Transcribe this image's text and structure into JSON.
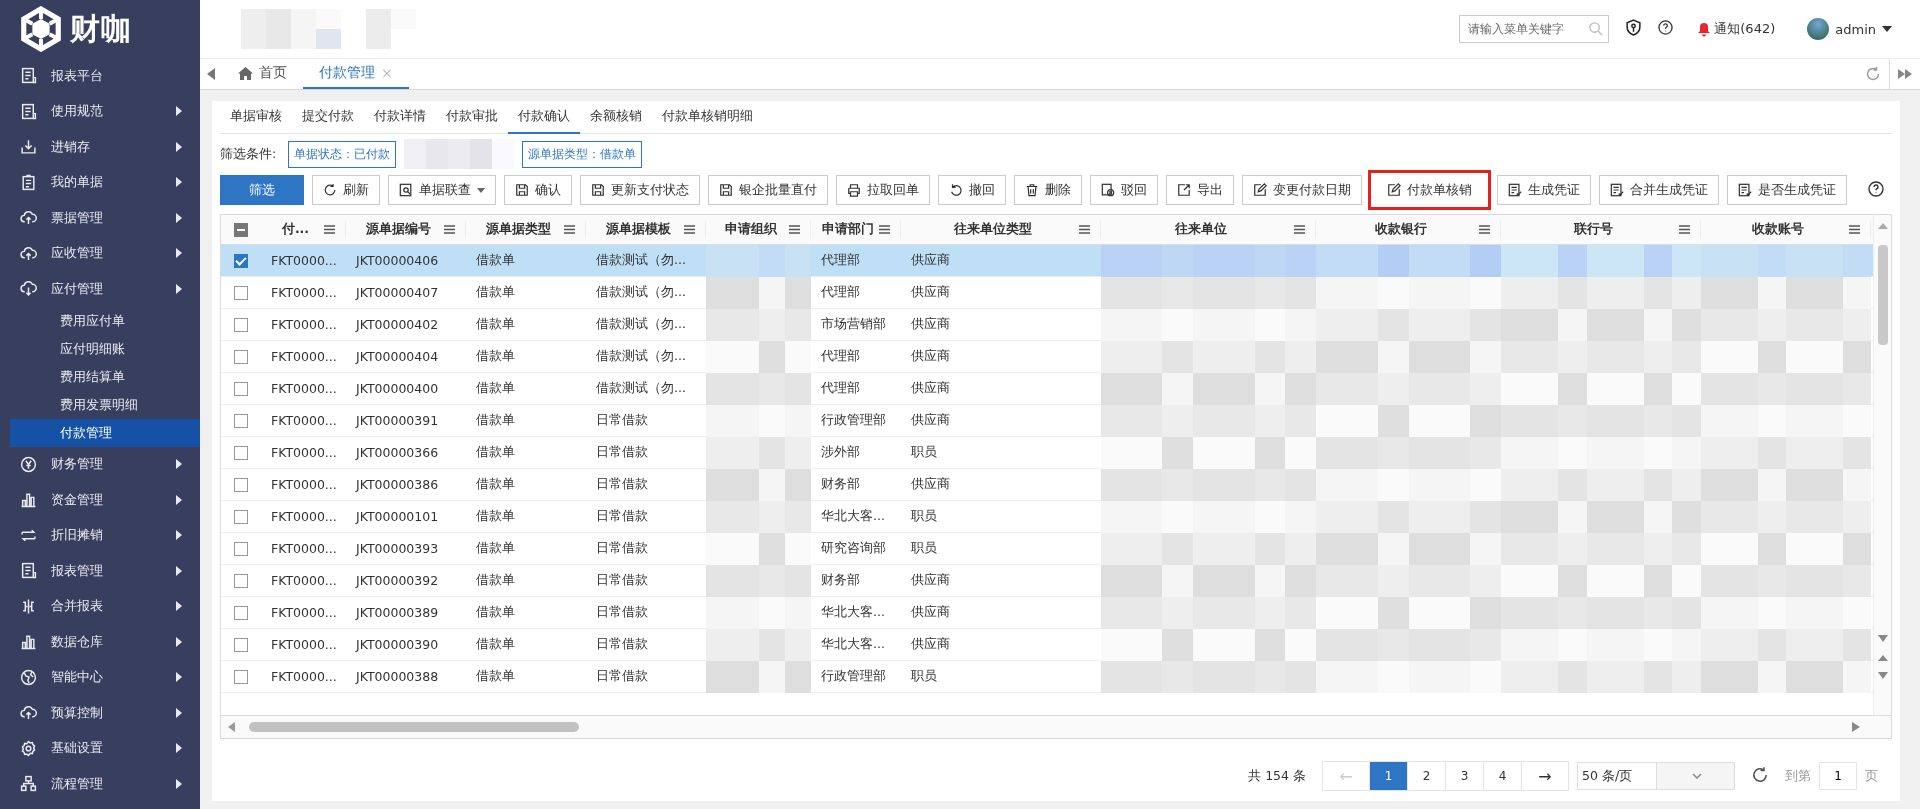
{
  "logo": {
    "text": "财咖"
  },
  "sidebar": {
    "items": [
      {
        "label": "报表平台",
        "kind": "report",
        "expandable": false,
        "selected": false
      },
      {
        "label": "使用规范",
        "kind": "report",
        "expandable": true,
        "selected": false
      },
      {
        "label": "进销存",
        "kind": "download",
        "expandable": true,
        "selected": false
      },
      {
        "label": "我的单据",
        "kind": "clipboard",
        "expandable": true,
        "selected": false
      },
      {
        "label": "票据管理",
        "kind": "cloud-up",
        "expandable": true,
        "selected": false
      },
      {
        "label": "应收管理",
        "kind": "cloud-up",
        "expandable": true,
        "selected": false
      },
      {
        "label": "应付管理",
        "kind": "cloud-down",
        "expandable": true,
        "selected": false,
        "children": [
          {
            "label": "费用应付单",
            "selected": false
          },
          {
            "label": "应付明细账",
            "selected": false
          },
          {
            "label": "费用结算单",
            "selected": false
          },
          {
            "label": "费用发票明细",
            "selected": false
          },
          {
            "label": "付款管理",
            "selected": true
          }
        ]
      },
      {
        "label": "财务管理",
        "kind": "yen",
        "expandable": true,
        "selected": false
      },
      {
        "label": "资金管理",
        "kind": "bars",
        "expandable": true,
        "selected": false
      },
      {
        "label": "折旧摊销",
        "kind": "swap",
        "expandable": true,
        "selected": false
      },
      {
        "label": "报表管理",
        "kind": "report",
        "expandable": true,
        "selected": false
      },
      {
        "label": "合并报表",
        "kind": "merge",
        "expandable": true,
        "selected": false
      },
      {
        "label": "数据仓库",
        "kind": "bars",
        "expandable": true,
        "selected": false
      },
      {
        "label": "智能中心",
        "kind": "globe",
        "expandable": true,
        "selected": false
      },
      {
        "label": "预算控制",
        "kind": "cloud-up",
        "expandable": true,
        "selected": false
      },
      {
        "label": "基础设置",
        "kind": "gear",
        "expandable": true,
        "selected": false
      },
      {
        "label": "流程管理",
        "kind": "flow",
        "expandable": true,
        "selected": false
      }
    ]
  },
  "header": {
    "search": {
      "placeholder": "请输入菜单关键字"
    },
    "notifications": "通知(642)",
    "user": "admin"
  },
  "tabs": [
    {
      "label": "首页",
      "kind": "home",
      "selected": false
    },
    {
      "label": "付款管理",
      "kind": "page",
      "selected": true,
      "close": "×"
    }
  ],
  "subtabs": [
    {
      "label": "单据审核",
      "selected": false
    },
    {
      "label": "提交付款",
      "selected": false
    },
    {
      "label": "付款详情",
      "selected": false
    },
    {
      "label": "付款审批",
      "selected": false
    },
    {
      "label": "付款确认",
      "selected": true
    },
    {
      "label": "余额核销",
      "selected": false
    },
    {
      "label": "付款单核销明细",
      "selected": false
    }
  ],
  "filter": {
    "label": "筛选条件:",
    "chips": [
      "单据状态：已付款",
      "源单据类型：借款单"
    ]
  },
  "toolbar": [
    {
      "label": "筛选",
      "kind": "primary",
      "highlighted": false
    },
    {
      "label": "刷新",
      "kind": "refresh",
      "highlighted": false
    },
    {
      "label": "单据联查",
      "kind": "search-doc",
      "dropdown": true,
      "highlighted": false
    },
    {
      "label": "确认",
      "kind": "save",
      "highlighted": false
    },
    {
      "label": "更新支付状态",
      "kind": "save",
      "highlighted": false
    },
    {
      "label": "银企批量直付",
      "kind": "save",
      "highlighted": false
    },
    {
      "label": "拉取回单",
      "kind": "printer",
      "highlighted": false
    },
    {
      "label": "撤回",
      "kind": "undo",
      "highlighted": false
    },
    {
      "label": "删除",
      "kind": "trash",
      "highlighted": false
    },
    {
      "label": "驳回",
      "kind": "cancel",
      "highlighted": false
    },
    {
      "label": "导出",
      "kind": "export",
      "highlighted": false
    },
    {
      "label": "变更付款日期",
      "kind": "edit",
      "highlighted": false
    },
    {
      "label": "付款单核销",
      "kind": "edit",
      "highlighted": true
    },
    {
      "label": "生成凭证",
      "kind": "list",
      "highlighted": false
    },
    {
      "label": "合并生成凭证",
      "kind": "list",
      "highlighted": false
    },
    {
      "label": "是否生成凭证",
      "kind": "list",
      "highlighted": false
    }
  ],
  "table": {
    "select_all_partial": true,
    "columns": [
      {
        "label": "付..."
      },
      {
        "label": "源单据编号"
      },
      {
        "label": "源单据类型"
      },
      {
        "label": "源单据模板"
      },
      {
        "label": "申请组织"
      },
      {
        "label": "申请部门"
      },
      {
        "label": "往来单位类型"
      },
      {
        "label": "往来单位"
      },
      {
        "label": "收款银行"
      },
      {
        "label": "联行号"
      },
      {
        "label": "收款账号"
      }
    ],
    "rows": [
      {
        "selected": true,
        "cells": [
          "FKT0000...",
          "JKT00000406",
          "借款单",
          "借款测试（勿...",
          "",
          "代理部",
          "供应商"
        ]
      },
      {
        "selected": false,
        "cells": [
          "FKT0000...",
          "JKT00000407",
          "借款单",
          "借款测试（勿...",
          "",
          "代理部",
          "供应商"
        ]
      },
      {
        "selected": false,
        "cells": [
          "FKT0000...",
          "JKT00000402",
          "借款单",
          "借款测试（勿...",
          "",
          "市场营销部",
          "供应商"
        ]
      },
      {
        "selected": false,
        "cells": [
          "FKT0000...",
          "JKT00000404",
          "借款单",
          "借款测试（勿...",
          "",
          "代理部",
          "供应商"
        ]
      },
      {
        "selected": false,
        "cells": [
          "FKT0000...",
          "JKT00000400",
          "借款单",
          "借款测试（勿...",
          "",
          "代理部",
          "供应商"
        ]
      },
      {
        "selected": false,
        "cells": [
          "FKT0000...",
          "JKT00000391",
          "借款单",
          "日常借款",
          "",
          "行政管理部",
          "供应商"
        ]
      },
      {
        "selected": false,
        "cells": [
          "FKT0000...",
          "JKT00000366",
          "借款单",
          "日常借款",
          "",
          "涉外部",
          "职员"
        ]
      },
      {
        "selected": false,
        "cells": [
          "FKT0000...",
          "JKT00000386",
          "借款单",
          "日常借款",
          "",
          "财务部",
          "供应商"
        ]
      },
      {
        "selected": false,
        "cells": [
          "FKT0000...",
          "JKT00000101",
          "借款单",
          "日常借款",
          "",
          "华北大客...",
          "职员"
        ]
      },
      {
        "selected": false,
        "cells": [
          "FKT0000...",
          "JKT00000393",
          "借款单",
          "日常借款",
          "",
          "研究咨询部",
          "职员"
        ]
      },
      {
        "selected": false,
        "cells": [
          "FKT0000...",
          "JKT00000392",
          "借款单",
          "日常借款",
          "",
          "财务部",
          "供应商"
        ]
      },
      {
        "selected": false,
        "cells": [
          "FKT0000...",
          "JKT00000389",
          "借款单",
          "日常借款",
          "",
          "华北大客...",
          "供应商"
        ]
      },
      {
        "selected": false,
        "cells": [
          "FKT0000...",
          "JKT00000390",
          "借款单",
          "日常借款",
          "",
          "华北大客...",
          "供应商"
        ]
      },
      {
        "selected": false,
        "cells": [
          "FKT0000...",
          "JKT00000388",
          "借款单",
          "日常借款",
          "",
          "行政管理部",
          "职员"
        ]
      }
    ]
  },
  "pager": {
    "total": "共 154 条",
    "prev": "←",
    "next": "→",
    "pages": [
      {
        "label": "1",
        "selected": true
      },
      {
        "label": "2",
        "selected": false
      },
      {
        "label": "3",
        "selected": false
      },
      {
        "label": "4",
        "selected": false
      }
    ],
    "page_size": "50 条/页",
    "goto_label": "到第",
    "goto_value": "1",
    "goto_suffix": "页"
  }
}
